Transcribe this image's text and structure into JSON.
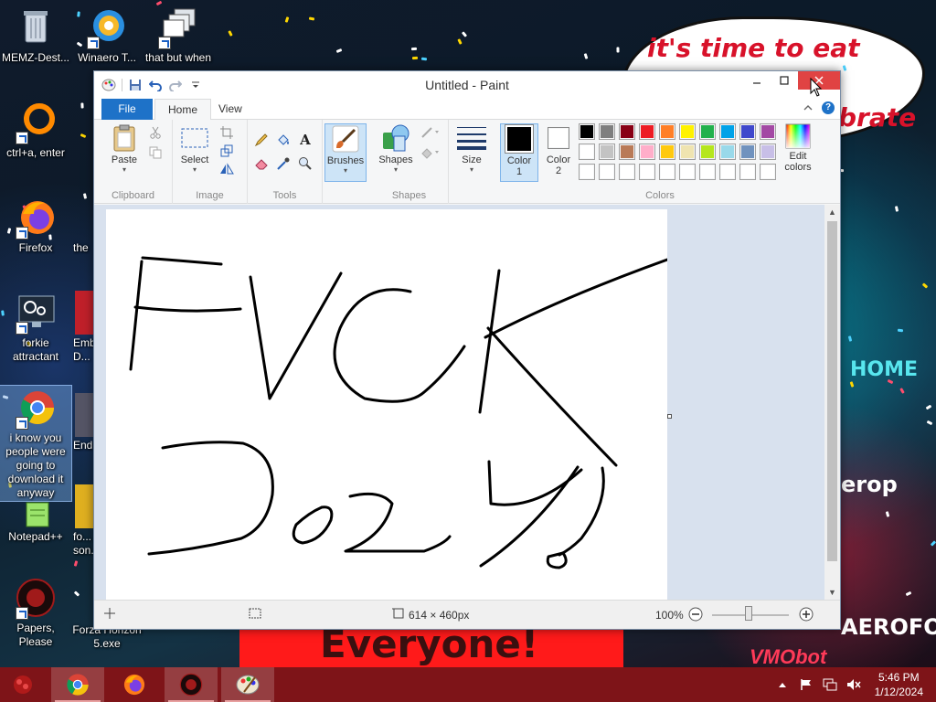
{
  "desktop": {
    "speech_bubble_text": "it's time to eat shit",
    "speech_bubble_text_2": "ebrate",
    "wallpaper_banner_text": "Everyone!",
    "wallpaper_sign_home": "HOME",
    "wallpaper_sign_aero_1": "erop",
    "wallpaper_sign_aero_2": "AEROFOS",
    "wallpaper_sign_vm": "VMObot",
    "icons": [
      {
        "label": "MEMZ-Dest...",
        "icon": "recycle-bin-icon"
      },
      {
        "label": "Winaero T...",
        "icon": "winaero-icon"
      },
      {
        "label": "that but when",
        "icon": "stacked-windows-icon"
      },
      {
        "label": "ctrl+a, enter",
        "icon": "orange-ring-icon"
      },
      {
        "label": "Firefox",
        "icon": "firefox-icon"
      },
      {
        "label": "the",
        "icon": "partial-icon"
      },
      {
        "label": "forkie attractant",
        "icon": "monitor-gear-icon"
      },
      {
        "label": "Emb... D...",
        "icon": "partial-icon"
      },
      {
        "label": "i know you people were going to download it anyway",
        "icon": "chrome-icon"
      },
      {
        "label": "End",
        "icon": "partial-icon"
      },
      {
        "label": "Notepad++",
        "icon": "notepadpp-icon"
      },
      {
        "label": "fo... son...",
        "icon": "partial-icon"
      },
      {
        "label": "Papers, Please",
        "icon": "papers-please-icon"
      },
      {
        "label": "Forza Horizon 5.exe",
        "icon": "forza-icon"
      }
    ]
  },
  "paint": {
    "window_title": "Untitled - Paint",
    "tabs": {
      "file": "File",
      "home": "Home",
      "view": "View"
    },
    "groups": {
      "clipboard": "Clipboard",
      "image": "Image",
      "tools": "Tools",
      "shapes": "Shapes",
      "colors": "Colors"
    },
    "buttons": {
      "paste": "Paste",
      "select": "Select",
      "brushes": "Brushes",
      "shapes": "Shapes",
      "size": "Size",
      "color1": "Color 1",
      "color1_a": "Color",
      "color1_b": "1",
      "color2_a": "Color",
      "color2_b": "2",
      "edit_colors_a": "Edit",
      "edit_colors_b": "colors"
    },
    "palette": {
      "row1": [
        "#000000",
        "#7f7f7f",
        "#880015",
        "#ed1c24",
        "#ff7f27",
        "#fff200",
        "#22b14c",
        "#00a2e8",
        "#3f48cc",
        "#a349a4"
      ],
      "row2": [
        "#ffffff",
        "#c3c3c3",
        "#b97a57",
        "#ffaec9",
        "#ffc90e",
        "#efe4b0",
        "#b5e61d",
        "#99d9ea",
        "#7092be",
        "#c8bfe7"
      ],
      "row3": [
        "#ffffff",
        "#ffffff",
        "#ffffff",
        "#ffffff",
        "#ffffff",
        "#ffffff",
        "#ffffff",
        "#ffffff",
        "#ffffff",
        "#ffffff"
      ]
    },
    "color1_value": "#000000",
    "color2_value": "#ffffff",
    "status": {
      "canvas_size": "614 × 460px",
      "zoom": "100%"
    }
  },
  "taskbar": {
    "apps": [
      {
        "name": "chrome",
        "icon": "chrome-icon",
        "active": true
      },
      {
        "name": "firefox",
        "icon": "firefox-icon",
        "active": false
      },
      {
        "name": "papers-please",
        "icon": "papers-please-icon",
        "active": false
      },
      {
        "name": "paint",
        "icon": "paint-palette-icon",
        "active": true
      }
    ],
    "time": "5:46 PM",
    "date": "1/12/2024"
  }
}
